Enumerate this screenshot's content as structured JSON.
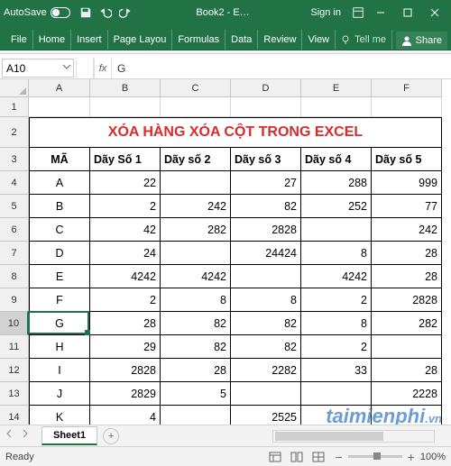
{
  "titlebar": {
    "autosave_label": "AutoSave",
    "book": "Book2  -  E…",
    "signin": "Sign in"
  },
  "ribbon": {
    "tabs": [
      "File",
      "Home",
      "Insert",
      "Page Layou",
      "Formulas",
      "Data",
      "Review",
      "View"
    ],
    "tellme": "Tell me",
    "share": "Share"
  },
  "namebox": "A10",
  "formula": "G",
  "columns": [
    "A",
    "B",
    "C",
    "D",
    "E",
    "F"
  ],
  "title_row": "XÓA HÀNG XÓA CỘT TRONG EXCEL",
  "headers": [
    "MÃ",
    "Dãy Số 1",
    "Dãy số 2",
    "Dãy số 3",
    "Dãy số 4",
    "Dãy số 5"
  ],
  "data": [
    {
      "n": 4,
      "c": [
        "A",
        "22",
        "",
        "27",
        "288",
        "999"
      ]
    },
    {
      "n": 5,
      "c": [
        "B",
        "2",
        "242",
        "82",
        "252",
        "77"
      ]
    },
    {
      "n": 6,
      "c": [
        "C",
        "42",
        "282",
        "2828",
        "",
        "242"
      ]
    },
    {
      "n": 7,
      "c": [
        "D",
        "24",
        "",
        "24424",
        "8",
        "28"
      ]
    },
    {
      "n": 8,
      "c": [
        "E",
        "4242",
        "4242",
        "",
        "4242",
        "28"
      ]
    },
    {
      "n": 9,
      "c": [
        "F",
        "2",
        "8",
        "8",
        "2",
        "2828"
      ]
    },
    {
      "n": 10,
      "c": [
        "G",
        "28",
        "82",
        "82",
        "8",
        "282"
      ]
    },
    {
      "n": 11,
      "c": [
        "H",
        "29",
        "82",
        "82",
        "2",
        ""
      ]
    },
    {
      "n": 12,
      "c": [
        "I",
        "2828",
        "28",
        "2282",
        "33",
        "28"
      ]
    },
    {
      "n": 13,
      "c": [
        "J",
        "2829",
        "5",
        "",
        "",
        "2228"
      ]
    },
    {
      "n": 14,
      "c": [
        "K",
        "4",
        "",
        "2525",
        "",
        ""
      ]
    }
  ],
  "sheet": {
    "name": "Sheet1"
  },
  "status": {
    "ready": "Ready",
    "zoom": "100%"
  },
  "watermark": "taimienphi",
  "watermark_tld": ".vn",
  "active": {
    "row": 10,
    "col": "A"
  }
}
